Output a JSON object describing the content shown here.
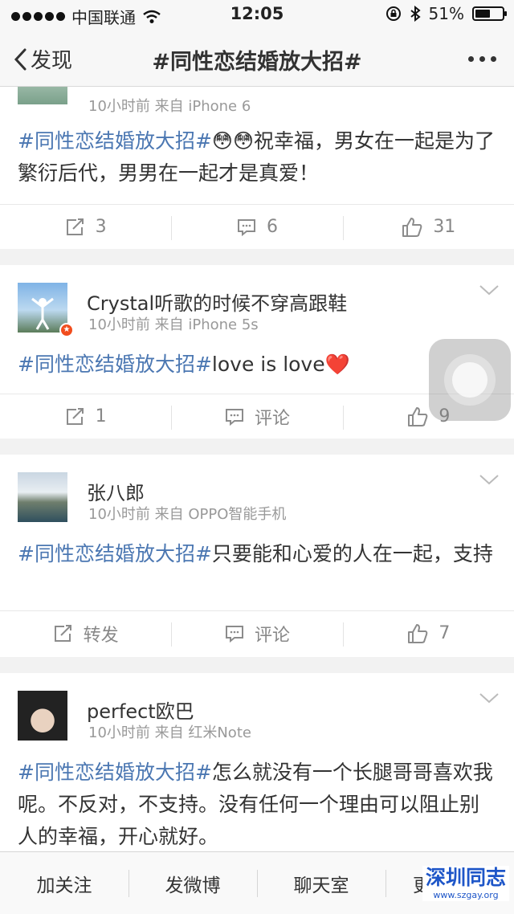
{
  "status_bar": {
    "carrier": "中国联通",
    "time": "12:05",
    "battery": "51%"
  },
  "nav": {
    "back_label": "发现",
    "title": "#同性恋结婚放大招#"
  },
  "posts": [
    {
      "username": "",
      "meta": "10小时前  来自 iPhone 6",
      "hashtag": "#同性恋结婚放大招#",
      "text": "😳😳祝幸福，男女在一起是为了繁衍后代，男男在一起才是真爱！",
      "repost": "3",
      "comment": "6",
      "like": "31"
    },
    {
      "username": "Crystal听歌的时候不穿高跟鞋",
      "meta": "10小时前  来自 iPhone 5s",
      "hashtag": "#同性恋结婚放大招#",
      "text": "love is love❤️",
      "repost": "1",
      "comment": "评论",
      "like": "9"
    },
    {
      "username": "张八郎",
      "meta": "10小时前  来自 OPPO智能手机",
      "hashtag": "#同性恋结婚放大招#",
      "text": "只要能和心爱的人在一起，支持",
      "repost": "转发",
      "comment": "评论",
      "like": "7"
    },
    {
      "username": "perfect欧巴",
      "meta": "10小时前  来自 红米Note",
      "hashtag": "#同性恋结婚放大招#",
      "text": "怎么就没有一个长腿哥哥喜欢我呢。不反对，不支持。没有任何一个理由可以阻止别人的幸福，开心就好。"
    }
  ],
  "tab_bar": {
    "tabs": [
      "加关注",
      "发微博",
      "聊天室",
      "更多内容"
    ]
  },
  "watermark": {
    "name": "深圳同志",
    "url": "www.szgay.org"
  },
  "colors": {
    "hashtag": "#4b77b2",
    "icon": "#8c8c8c"
  },
  "icons": [
    "back-chevron-icon",
    "more-dots-icon",
    "repost-icon",
    "comment-icon",
    "like-icon",
    "dropdown-chevron-icon",
    "wifi-icon",
    "bluetooth-icon",
    "lock-rotation-icon"
  ]
}
